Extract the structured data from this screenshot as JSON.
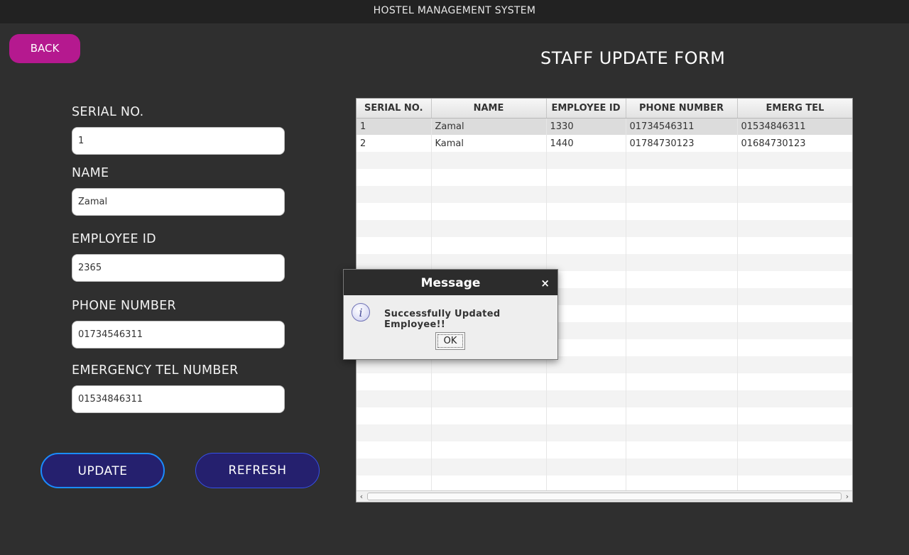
{
  "window": {
    "title": "HOSTEL MANAGEMENT SYSTEM"
  },
  "back_label": "BACK",
  "form_title": "STAFF UPDATE FORM",
  "fields": {
    "serial": {
      "label": "SERIAL NO.",
      "value": "1"
    },
    "name": {
      "label": "NAME",
      "value": "Zamal"
    },
    "employee_id": {
      "label": "EMPLOYEE ID",
      "value": "2365"
    },
    "phone": {
      "label": "PHONE NUMBER",
      "value": "01734546311"
    },
    "emergency": {
      "label": "EMERGENCY TEL NUMBER",
      "value": "01534846311"
    }
  },
  "buttons": {
    "update": "UPDATE",
    "refresh": "REFRESH"
  },
  "table": {
    "columns": [
      "SERIAL NO.",
      "NAME",
      "EMPLOYEE ID",
      "PHONE NUMBER",
      "EMERG TEL"
    ],
    "rows": [
      [
        "1",
        "Zamal",
        "1330",
        "01734546311",
        "01534846311"
      ],
      [
        "2",
        "Kamal",
        "1440",
        "01784730123",
        "01684730123"
      ]
    ],
    "selected_row": 1
  },
  "dialog": {
    "title": "Message",
    "close_icon": "×",
    "icon": "info-icon",
    "message": "Successfully Updated Employee!!",
    "ok_label": "OK"
  },
  "colors": {
    "background": "#2f2f2f",
    "titlebar": "#222222",
    "back_button": "#b5198f",
    "action_button": "#25206e",
    "action_border": "#1a8cff"
  }
}
